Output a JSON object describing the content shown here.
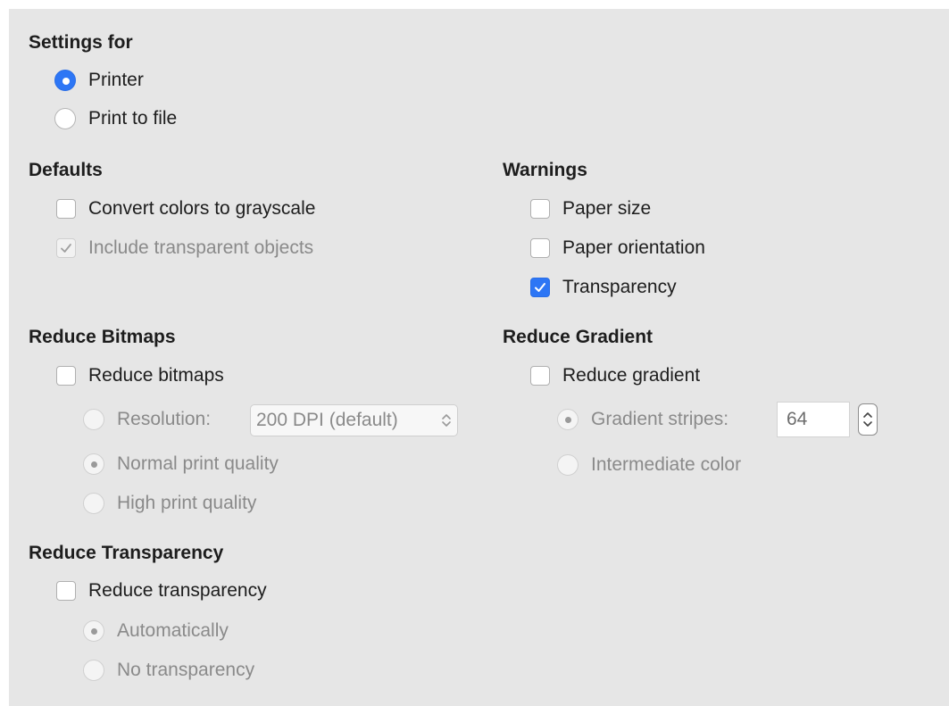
{
  "settings_for": {
    "heading": "Settings for",
    "options": [
      {
        "label": "Printer",
        "selected": true
      },
      {
        "label": "Print to file",
        "selected": false
      }
    ]
  },
  "defaults": {
    "heading": "Defaults",
    "convert_grayscale": {
      "label": "Convert colors to grayscale",
      "checked": false,
      "enabled": true
    },
    "include_transparent": {
      "label": "Include transparent objects",
      "checked": true,
      "enabled": false
    }
  },
  "warnings": {
    "heading": "Warnings",
    "paper_size": {
      "label": "Paper size",
      "checked": false
    },
    "paper_orientation": {
      "label": "Paper orientation",
      "checked": false
    },
    "transparency": {
      "label": "Transparency",
      "checked": true
    }
  },
  "reduce_bitmaps": {
    "heading": "Reduce Bitmaps",
    "checkbox": {
      "label": "Reduce bitmaps",
      "checked": false
    },
    "resolution": {
      "label": "Resolution:",
      "value": "200 DPI (default)",
      "selected": false
    },
    "normal_quality": {
      "label": "Normal print quality",
      "selected": true
    },
    "high_quality": {
      "label": "High print quality",
      "selected": false
    }
  },
  "reduce_gradient": {
    "heading": "Reduce Gradient",
    "checkbox": {
      "label": "Reduce gradient",
      "checked": false
    },
    "stripes": {
      "label": "Gradient stripes:",
      "value": "64",
      "selected": true
    },
    "intermediate": {
      "label": "Intermediate color",
      "selected": false
    }
  },
  "reduce_transparency": {
    "heading": "Reduce Transparency",
    "checkbox": {
      "label": "Reduce transparency",
      "checked": false
    },
    "automatically": {
      "label": "Automatically",
      "selected": true
    },
    "no_transparency": {
      "label": "No transparency",
      "selected": false
    }
  },
  "colors": {
    "accent": "#2d76f5",
    "panel_bg": "#e6e6e6",
    "disabled_text": "#8a8a8a"
  }
}
